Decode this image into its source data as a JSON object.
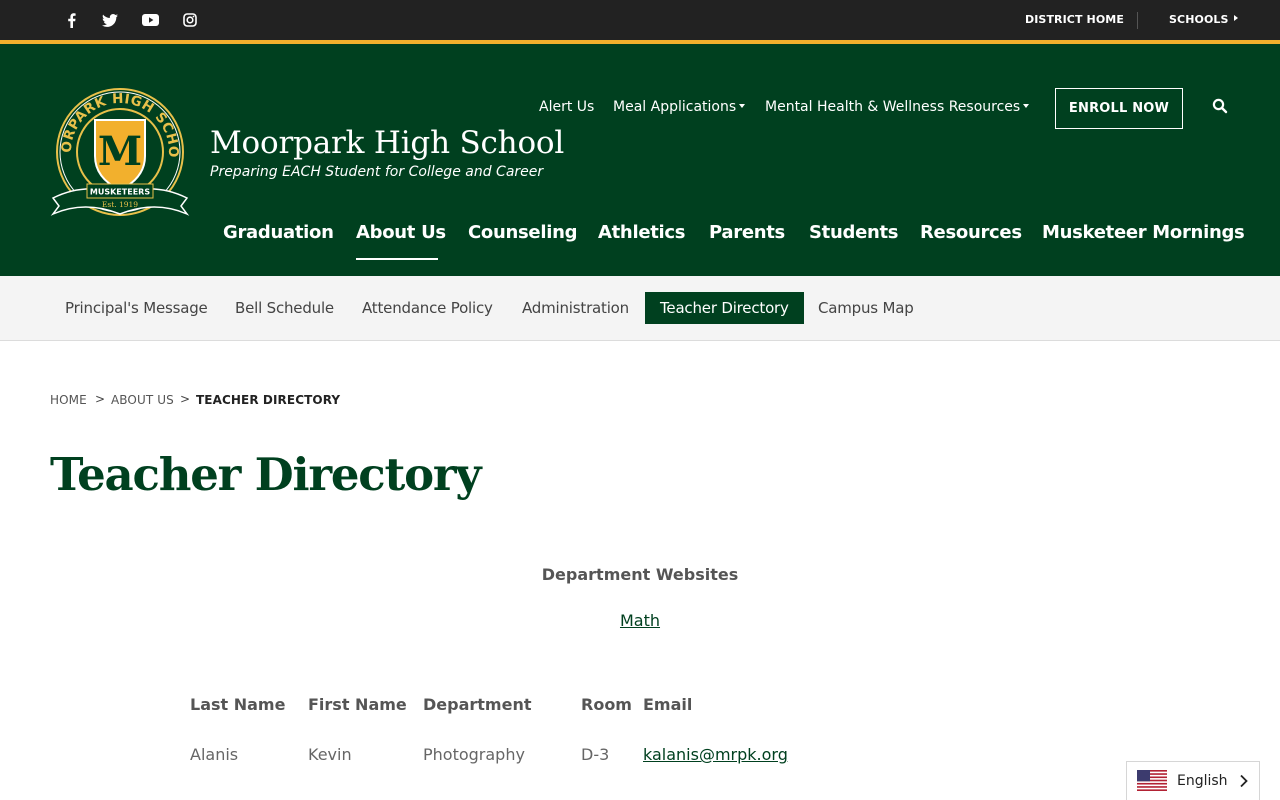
{
  "topbar": {
    "social": [
      "facebook-icon",
      "twitter-icon",
      "youtube-icon",
      "instagram-icon"
    ],
    "district_home": "DISTRICT HOME",
    "schools": "SCHOOLS"
  },
  "header": {
    "school_name": "Moorpark High School",
    "tagline": "Preparing EACH Student for College and Career",
    "logo_text": {
      "arc": "MOORPARK HIGH SCHOOL",
      "letter": "M",
      "ribbon": "MUSKETEERS",
      "est": "Est. 1919"
    },
    "upper_nav": {
      "alert_us": "Alert Us",
      "meal_applications": "Meal Applications",
      "mental_health": "Mental Health & Wellness Resources"
    },
    "enroll_now": "ENROLL NOW",
    "main_nav": {
      "graduation": "Graduation",
      "about_us": "About Us",
      "counseling": "Counseling",
      "athletics": "Athletics",
      "parents": "Parents",
      "students": "Students",
      "resources": "Resources",
      "musketeer_mornings": "Musketeer Mornings"
    }
  },
  "subnav": {
    "principals_message": "Principal's Message",
    "bell_schedule": "Bell Schedule",
    "attendance_policy": "Attendance Policy",
    "administration": "Administration",
    "teacher_directory": "Teacher Directory",
    "campus_map": "Campus Map"
  },
  "breadcrumb": {
    "home": "HOME",
    "about_us": "ABOUT US",
    "current": "TEACHER DIRECTORY",
    "separator": ">"
  },
  "page_title": "Teacher Directory",
  "department": {
    "heading": "Department Websites",
    "link": "Math"
  },
  "table": {
    "headers": {
      "last_name": "Last Name",
      "first_name": "First Name",
      "department": "Department",
      "room": "Room",
      "email": "Email"
    },
    "rows": [
      {
        "last_name": "Alanis",
        "first_name": "Kevin",
        "department": "Photography",
        "room": "D-3",
        "email": "kalanis@mrpk.org"
      }
    ]
  },
  "language": {
    "label": "English"
  },
  "colors": {
    "brand_green": "#00401f",
    "accent_gold": "#f2b02d",
    "topbar": "#222222"
  }
}
